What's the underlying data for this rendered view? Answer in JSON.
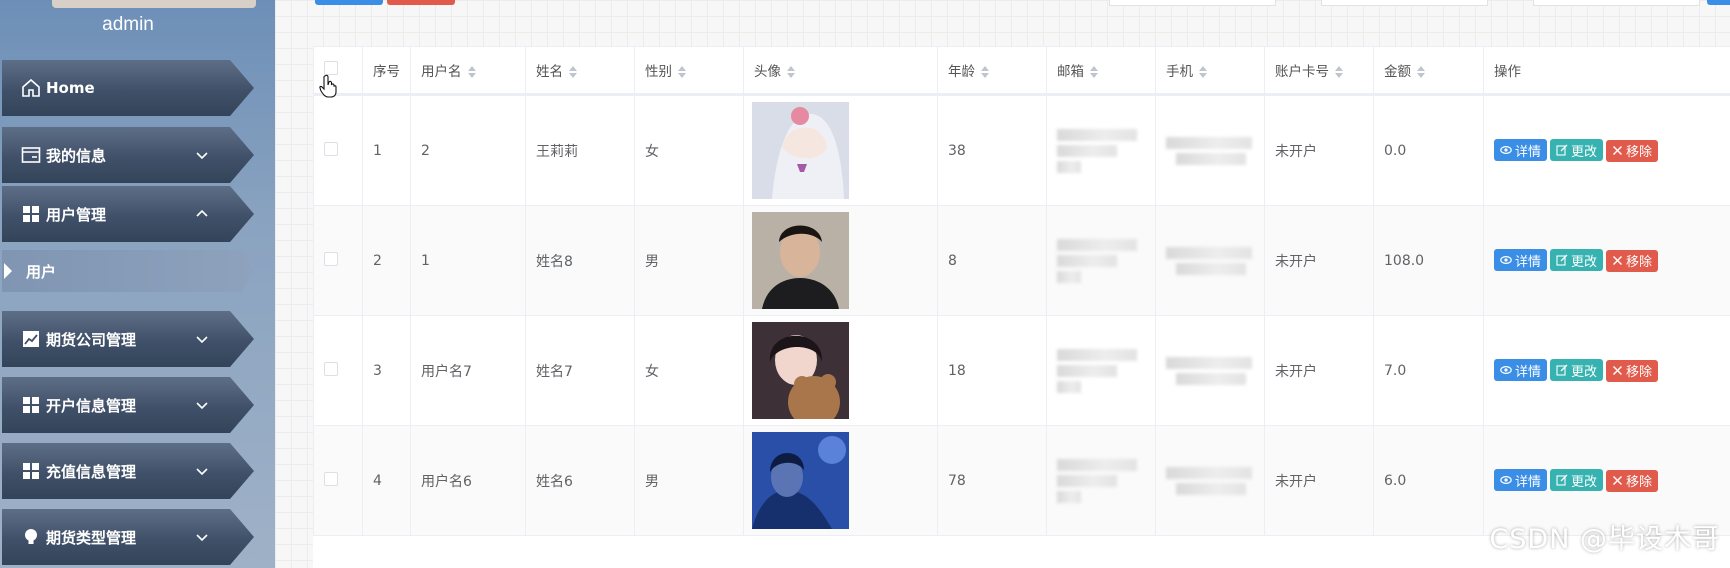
{
  "sidebar": {
    "username": "admin",
    "menu": [
      {
        "label": "Home",
        "icon": "home-icon"
      },
      {
        "label": "我的信息",
        "icon": "id-card-icon"
      },
      {
        "label": "用户管理",
        "icon": "grid-icon"
      },
      {
        "label": "期货公司管理",
        "icon": "trend-chart-icon"
      },
      {
        "label": "开户信息管理",
        "icon": "grid-icon"
      },
      {
        "label": "充值信息管理",
        "icon": "grid-icon"
      },
      {
        "label": "期货类型管理",
        "icon": "bulb-icon"
      }
    ],
    "submenu": {
      "label": "用户"
    }
  },
  "table": {
    "headers": [
      "序号",
      "用户名",
      "姓名",
      "性别",
      "头像",
      "年龄",
      "邮箱",
      "手机",
      "账户卡号",
      "金额",
      "操作"
    ],
    "rows": [
      {
        "index": "1",
        "username": "2",
        "name": "王莉莉",
        "gender": "女",
        "age": "38",
        "account": "未开户",
        "amount": "0.0"
      },
      {
        "index": "2",
        "username": "1",
        "name": "姓名8",
        "gender": "男",
        "age": "8",
        "account": "未开户",
        "amount": "108.0"
      },
      {
        "index": "3",
        "username": "用户名7",
        "name": "姓名7",
        "gender": "女",
        "age": "18",
        "account": "未开户",
        "amount": "7.0"
      },
      {
        "index": "4",
        "username": "用户名6",
        "name": "姓名6",
        "gender": "男",
        "age": "78",
        "account": "未开户",
        "amount": "6.0"
      }
    ],
    "actions": {
      "detail": "详情",
      "edit": "更改",
      "remove": "移除"
    }
  },
  "colors": {
    "detail": "#3a8ee6",
    "edit": "#36b3b0",
    "remove": "#e05b4b"
  },
  "watermark": "CSDN @毕设木哥"
}
